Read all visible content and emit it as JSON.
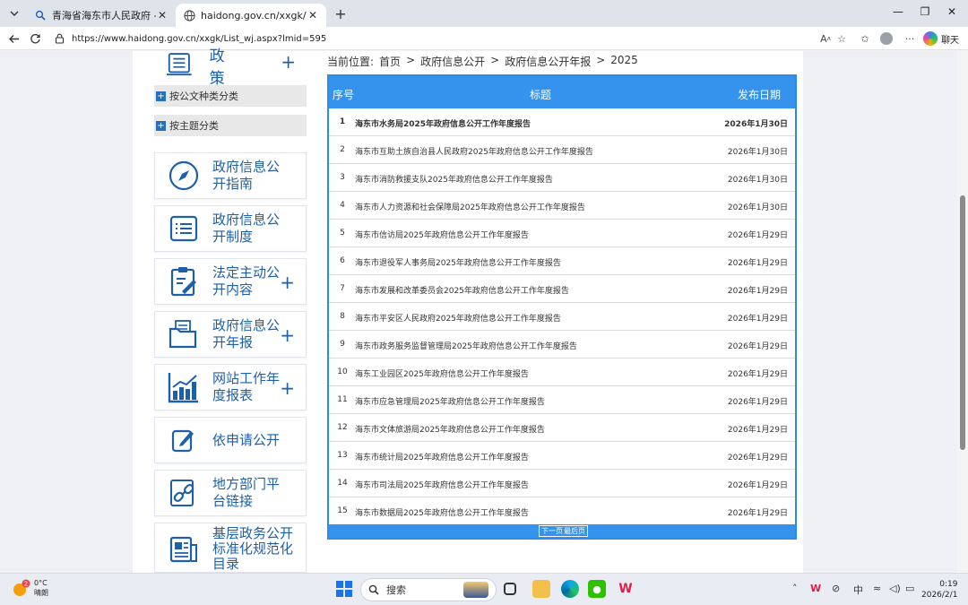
{
  "browser": {
    "tabs": [
      {
        "title": "青海省海东市人民政府 - 搜索",
        "active": false
      },
      {
        "title": "haidong.gov.cn/xxgk/List_wj.aspx",
        "active": true
      }
    ],
    "url": "https://www.haidong.gov.cn/xxgk/List_wj.aspx?lmid=595",
    "copilot_label": "聊天"
  },
  "sidebar": {
    "policy": {
      "label": "政  策"
    },
    "categories": [
      {
        "label": "按公文种类分类"
      },
      {
        "label": "按主题分类"
      }
    ],
    "cards": [
      {
        "label": "政府信息公开指南",
        "icon": "compass-icon",
        "expand": false
      },
      {
        "label": "政府信息公开制度",
        "icon": "list-document-icon",
        "expand": true
      },
      {
        "label": "法定主动公开内容",
        "icon": "clipboard-edit-icon",
        "expand": true
      },
      {
        "label": "政府信息公开年报",
        "icon": "folder-documents-icon",
        "expand": true
      },
      {
        "label": "网站工作年度报表",
        "icon": "bar-chart-icon",
        "expand": true
      },
      {
        "label": "依申请公开",
        "icon": "edit-form-icon",
        "expand": false
      },
      {
        "label": "地方部门平台链接",
        "icon": "link-icon",
        "expand": false
      },
      {
        "label": "基层政务公开标准化规范化目录",
        "icon": "newspaper-icon",
        "expand": false
      }
    ]
  },
  "breadcrumb": {
    "prefix": "当前位置:",
    "items": [
      "首页",
      "政府信息公开",
      "政府信息公开年报",
      "2025"
    ],
    "separator": ">"
  },
  "table": {
    "headers": {
      "num": "序号",
      "title": "标题",
      "date": "发布日期"
    },
    "rows": [
      {
        "num": "1",
        "title": "海东市水务局2025年政府信息公开工作年度报告",
        "date": "2026年1月30日"
      },
      {
        "num": "2",
        "title": "海东市互助土族自治县人民政府2025年政府信息公开工作年度报告",
        "date": "2026年1月30日"
      },
      {
        "num": "3",
        "title": "海东市消防救援支队2025年政府信息公开工作年度报告",
        "date": "2026年1月30日"
      },
      {
        "num": "4",
        "title": "海东市人力资源和社会保障局2025年政府信息公开工作年度报告",
        "date": "2026年1月30日"
      },
      {
        "num": "5",
        "title": "海东市信访局2025年政府信息公开工作年度报告",
        "date": "2026年1月29日"
      },
      {
        "num": "6",
        "title": "海东市退役军人事务局2025年政府信息公开工作年度报告",
        "date": "2026年1月29日"
      },
      {
        "num": "7",
        "title": "海东市发展和改革委员会2025年政府信息公开工作年度报告",
        "date": "2026年1月29日"
      },
      {
        "num": "8",
        "title": "海东市平安区人民政府2025年政府信息公开工作年度报告",
        "date": "2026年1月29日"
      },
      {
        "num": "9",
        "title": "海东市政务服务监督管理局2025年政府信息公开工作年度报告",
        "date": "2026年1月29日"
      },
      {
        "num": "10",
        "title": "海东工业园区2025年政府信息公开工作年度报告",
        "date": "2026年1月29日"
      },
      {
        "num": "11",
        "title": "海东市应急管理局2025年政府信息公开工作年度报告",
        "date": "2026年1月29日"
      },
      {
        "num": "12",
        "title": "海东市文体旅游局2025年政府信息公开工作年度报告",
        "date": "2026年1月29日"
      },
      {
        "num": "13",
        "title": "海东市统计局2025年政府信息公开工作年度报告",
        "date": "2026年1月29日"
      },
      {
        "num": "14",
        "title": "海东市司法局2025年政府信息公开工作年度报告",
        "date": "2026年1月29日"
      },
      {
        "num": "15",
        "title": "海东市数据局2025年政府信息公开工作年度报告",
        "date": "2026年1月29日"
      }
    ],
    "pager": {
      "next": "下一页",
      "last": "最后页"
    }
  },
  "taskbar": {
    "weather": {
      "temp": "0°C",
      "condition": "晴朗",
      "badge": "2"
    },
    "search_placeholder": "搜索",
    "tray_ime": "中",
    "time": "0:19",
    "date": "2026/2/1"
  },
  "colors": {
    "table_header": "#3593ee",
    "table_border": "#2f8be8",
    "nav_text": "#1d5fa8"
  }
}
